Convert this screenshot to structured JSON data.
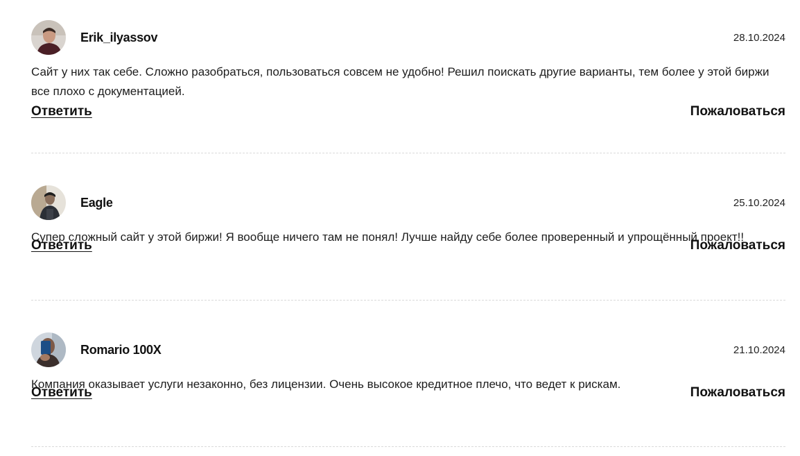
{
  "comments": [
    {
      "author": "Erik_ilyassov",
      "date": "28.10.2024",
      "text": "Сайт у них так себе. Сложно разобраться, пользоваться совсем не удобно! Решил поискать другие варианты, тем более у этой биржи все плохо с документацией.",
      "reply_label": "Ответить",
      "report_label": "Пожаловаться"
    },
    {
      "author": "Eagle",
      "date": "25.10.2024",
      "text": "Супер сложный сайт у этой биржи! Я вообще ничего там не понял! Лучше найду себе более проверенный и упрощённый проект!!",
      "reply_label": "Ответить",
      "report_label": "Пожаловаться"
    },
    {
      "author": "Romario 100X",
      "date": "21.10.2024",
      "text": "Компания оказывает услуги незаконно, без лицензии. Очень высокое кредитное плечо, что ведет к рискам.",
      "reply_label": "Ответить",
      "report_label": "Пожаловаться"
    }
  ]
}
